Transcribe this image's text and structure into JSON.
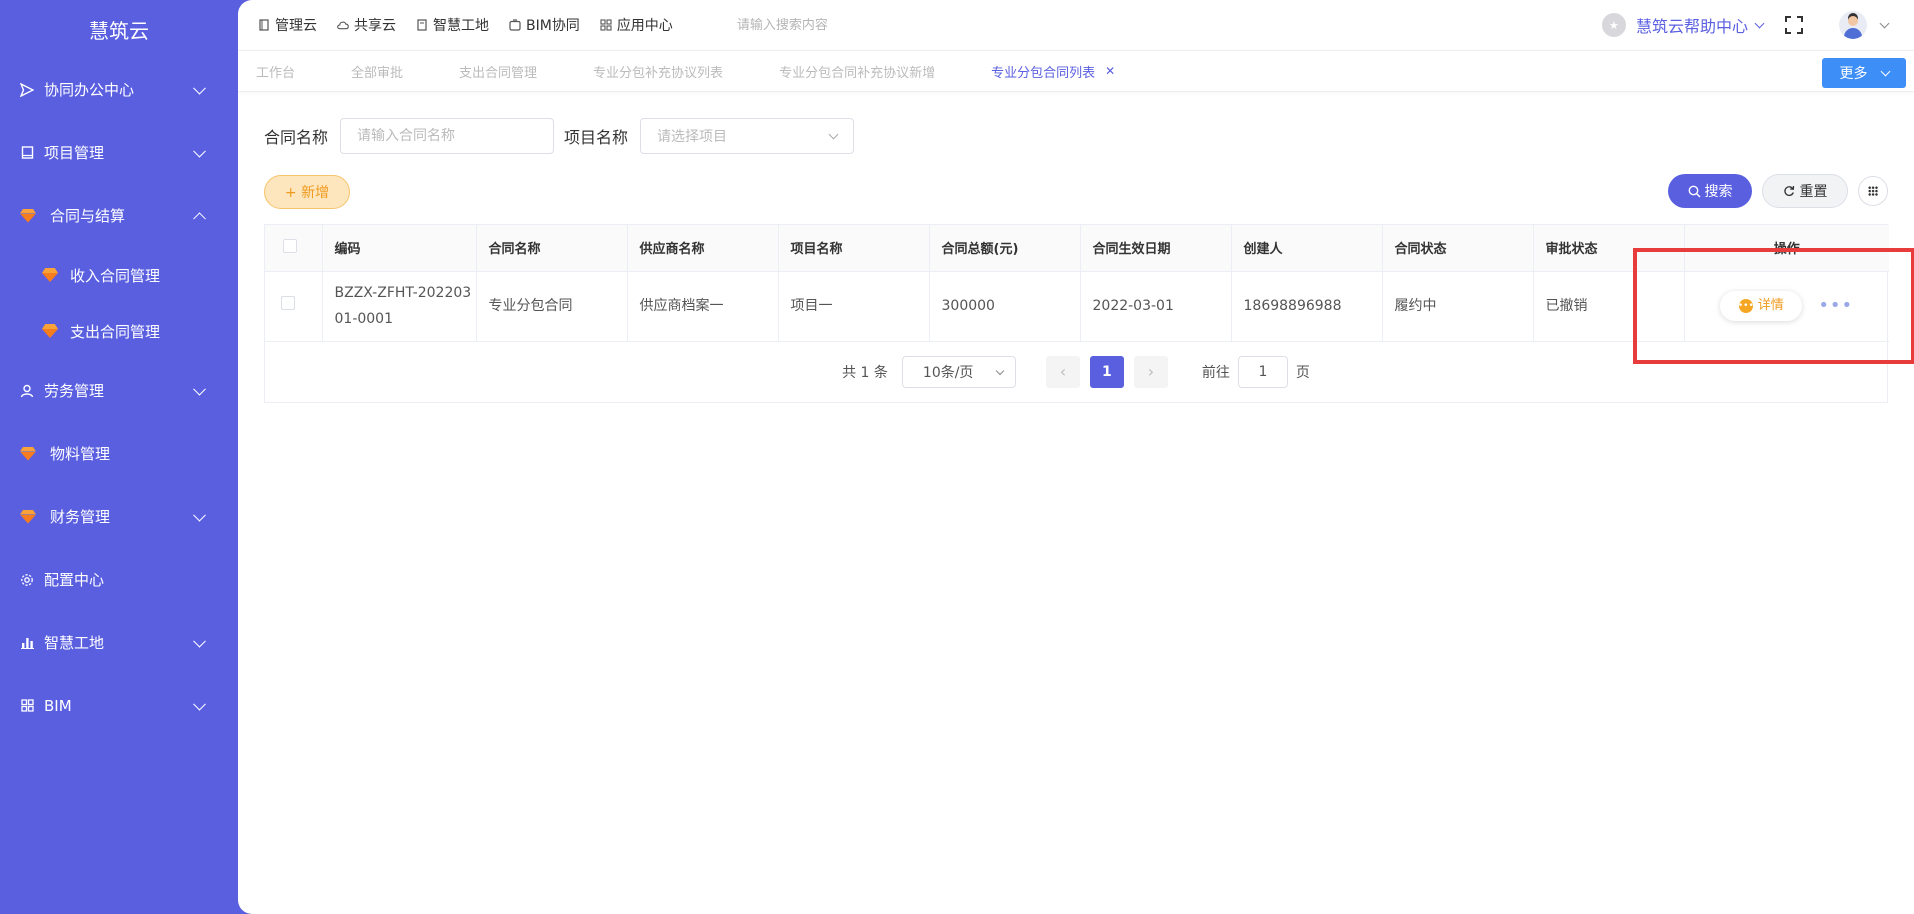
{
  "sidebar": {
    "brand": "慧筑云",
    "items": [
      {
        "label": "协同办公中心",
        "icon": "send-icon"
      },
      {
        "label": "项目管理",
        "icon": "book-icon"
      },
      {
        "label": "合同与结算",
        "icon": "gem-icon"
      },
      {
        "label": "收入合同管理",
        "icon": "gem-icon"
      },
      {
        "label": "支出合同管理",
        "icon": "gem-icon"
      },
      {
        "label": "劳务管理",
        "icon": "worker-icon"
      },
      {
        "label": "物料管理",
        "icon": "gem-icon"
      },
      {
        "label": "财务管理",
        "icon": "gem-icon"
      },
      {
        "label": "配置中心",
        "icon": "gear-icon"
      },
      {
        "label": "智慧工地",
        "icon": "bar-chart-icon"
      },
      {
        "label": "BIM",
        "icon": "grid-icon"
      }
    ]
  },
  "topbar": {
    "nav": [
      "管理云",
      "共享云",
      "智慧工地",
      "BIM协同",
      "应用中心"
    ],
    "search_placeholder": "请输入搜索内容",
    "help": "慧筑云帮助中心"
  },
  "tabs": [
    "工作台",
    "全部审批",
    "支出合同管理",
    "专业分包补充协议列表",
    "专业分包合同补充协议新增",
    "专业分包合同列表"
  ],
  "more_label": "更多",
  "filters": {
    "contract_name_label": "合同名称",
    "contract_name_placeholder": "请输入合同名称",
    "project_name_label": "项目名称",
    "project_name_placeholder": "请选择项目"
  },
  "actions": {
    "add": "+ 新增",
    "search": "搜索",
    "reset": "重置"
  },
  "table": {
    "headers": [
      "编码",
      "合同名称",
      "供应商名称",
      "项目名称",
      "合同总额(元)",
      "合同生效日期",
      "创建人",
      "合同状态",
      "审批状态",
      "操作"
    ],
    "rows": [
      {
        "code_line1": "BZZX-ZFHT-202203",
        "code_line2": "01-0001",
        "name": "专业分包合同",
        "supplier": "供应商档案一",
        "project": "项目一",
        "amount": "300000",
        "date": "2022-03-01",
        "creator": "18698896988",
        "status": "履约中",
        "approval": "已撤销",
        "detail": "详情"
      }
    ]
  },
  "pager": {
    "total": "共 1 条",
    "page_size": "10条/页",
    "current": "1",
    "goto_label": "前往",
    "goto_value": "1",
    "page_unit": "页"
  },
  "colors": {
    "sidebar": "#5a5fe0",
    "primary": "#5a5fe0",
    "accent_orange": "#f09a1f",
    "more_button": "#3e8ef7",
    "highlight": "#e83c3c"
  }
}
